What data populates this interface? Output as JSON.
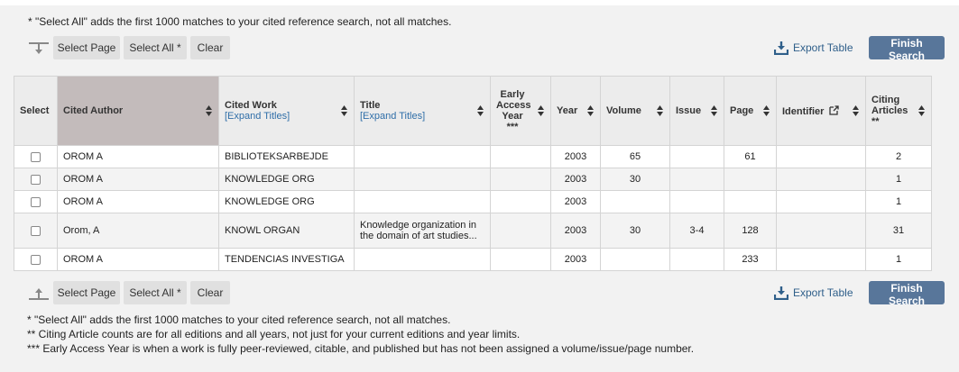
{
  "notes": {
    "select_all": "* \"Select All\" adds the first 1000 matches to your cited reference search, not all matches.",
    "citing": "** Citing Article counts are for all editions and all years, not just for your current editions and year limits.",
    "early_access": "*** Early Access Year is when a work is fully peer-reviewed, citable, and published but has not been assigned a volume/issue/page number."
  },
  "toolbar": {
    "select_page": "Select Page",
    "select_all": "Select All *",
    "clear": "Clear",
    "export": "Export Table",
    "finish": "Finish Search"
  },
  "columns": {
    "select": "Select",
    "cited_author": "Cited Author",
    "cited_work": "Cited Work",
    "expand_titles": "[Expand Titles]",
    "title": "Title",
    "early_access": "Early Access Year",
    "early_access_mark": "***",
    "year": "Year",
    "volume": "Volume",
    "issue": "Issue",
    "page": "Page",
    "identifier": "Identifier",
    "citing": "Citing Articles",
    "citing_mark": "**"
  },
  "rows": [
    {
      "author": "OROM A",
      "work": "BIBLIOTEKSARBEJDE",
      "title": "",
      "early": "",
      "year": "2003",
      "volume": "65",
      "issue": "",
      "page": "61",
      "identifier": "",
      "citing": "2"
    },
    {
      "author": "OROM A",
      "work": "KNOWLEDGE ORG",
      "title": "",
      "early": "",
      "year": "2003",
      "volume": "30",
      "issue": "",
      "page": "",
      "identifier": "",
      "citing": "1"
    },
    {
      "author": "OROM A",
      "work": "KNOWLEDGE ORG",
      "title": "",
      "early": "",
      "year": "2003",
      "volume": "",
      "issue": "",
      "page": "",
      "identifier": "",
      "citing": "1"
    },
    {
      "author": "Orom, A",
      "work": "KNOWL ORGAN",
      "title": "Knowledge organization in the domain of art studies...",
      "early": "",
      "year": "2003",
      "volume": "30",
      "issue": "3-4",
      "page": "128",
      "identifier": "",
      "citing": "31"
    },
    {
      "author": "OROM A",
      "work": "TENDENCIAS INVESTIGA",
      "title": "",
      "early": "",
      "year": "2003",
      "volume": "",
      "issue": "",
      "page": "233",
      "identifier": "",
      "citing": "1"
    }
  ],
  "colors": {
    "finish_button": "#58769a",
    "link": "#2f6ea8",
    "sorted_header": "#c3bbbb"
  }
}
